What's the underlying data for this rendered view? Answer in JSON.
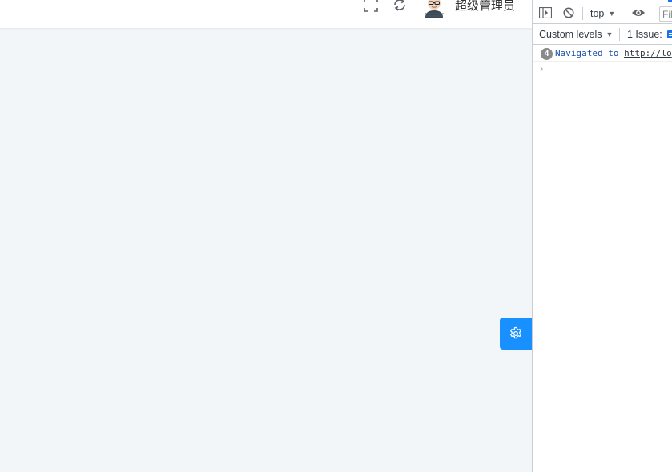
{
  "app": {
    "header": {
      "fullscreen_icon": "fullscreen-icon",
      "refresh_icon": "refresh-icon",
      "user_name": "超级管理员"
    },
    "settings_icon": "gear-icon",
    "colors": {
      "accent": "#1890ff",
      "background": "#f3f6f9",
      "header_bg": "#ffffff"
    }
  },
  "devtools": {
    "toolbar": {
      "sidebar_icon": "sidebar-toggle-icon",
      "clear_icon": "block-icon",
      "context": "top",
      "eye_icon": "eye-icon",
      "filter_placeholder": "Filter"
    },
    "toolbar2": {
      "levels": "Custom levels",
      "issues": "1 Issue:"
    },
    "messages": [
      {
        "count": "4",
        "text": "Navigated to",
        "link": "http://lo"
      }
    ],
    "prompt": "›",
    "colors": {
      "active_tab": "#1a73e8",
      "message_text": "#1a4fa8"
    }
  }
}
